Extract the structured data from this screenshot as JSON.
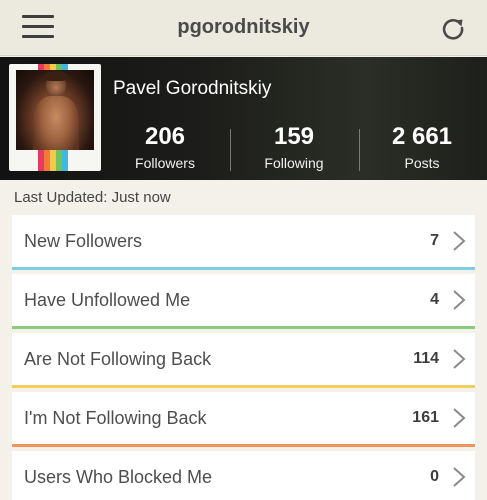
{
  "navbar": {
    "title": "pgorodnitskiy",
    "menu_icon": "hamburger-menu-icon",
    "refresh_icon": "refresh-icon"
  },
  "profile": {
    "name": "Pavel Gorodnitskiy",
    "stats": {
      "followers": {
        "value": "206",
        "label": "Followers"
      },
      "following": {
        "value": "159",
        "label": "Following"
      },
      "posts": {
        "value": "2 661",
        "label": "Posts"
      }
    }
  },
  "last_updated": "Last Updated: Just now",
  "list": [
    {
      "label": "New Followers",
      "count": "7",
      "color": "#7ccfe0"
    },
    {
      "label": "Have Unfollowed Me",
      "count": "4",
      "color": "#86cc7a"
    },
    {
      "label": "Are Not Following Back",
      "count": "114",
      "color": "#f3cd5a"
    },
    {
      "label": "I'm Not Following Back",
      "count": "161",
      "color": "#f0945e"
    },
    {
      "label": "Users Who Blocked Me",
      "count": "0",
      "color": "#e56a7c"
    }
  ],
  "colors": {
    "background": "#f3f1ea",
    "navbar": "#ece9df",
    "header_dark": "#1c1c1a"
  }
}
